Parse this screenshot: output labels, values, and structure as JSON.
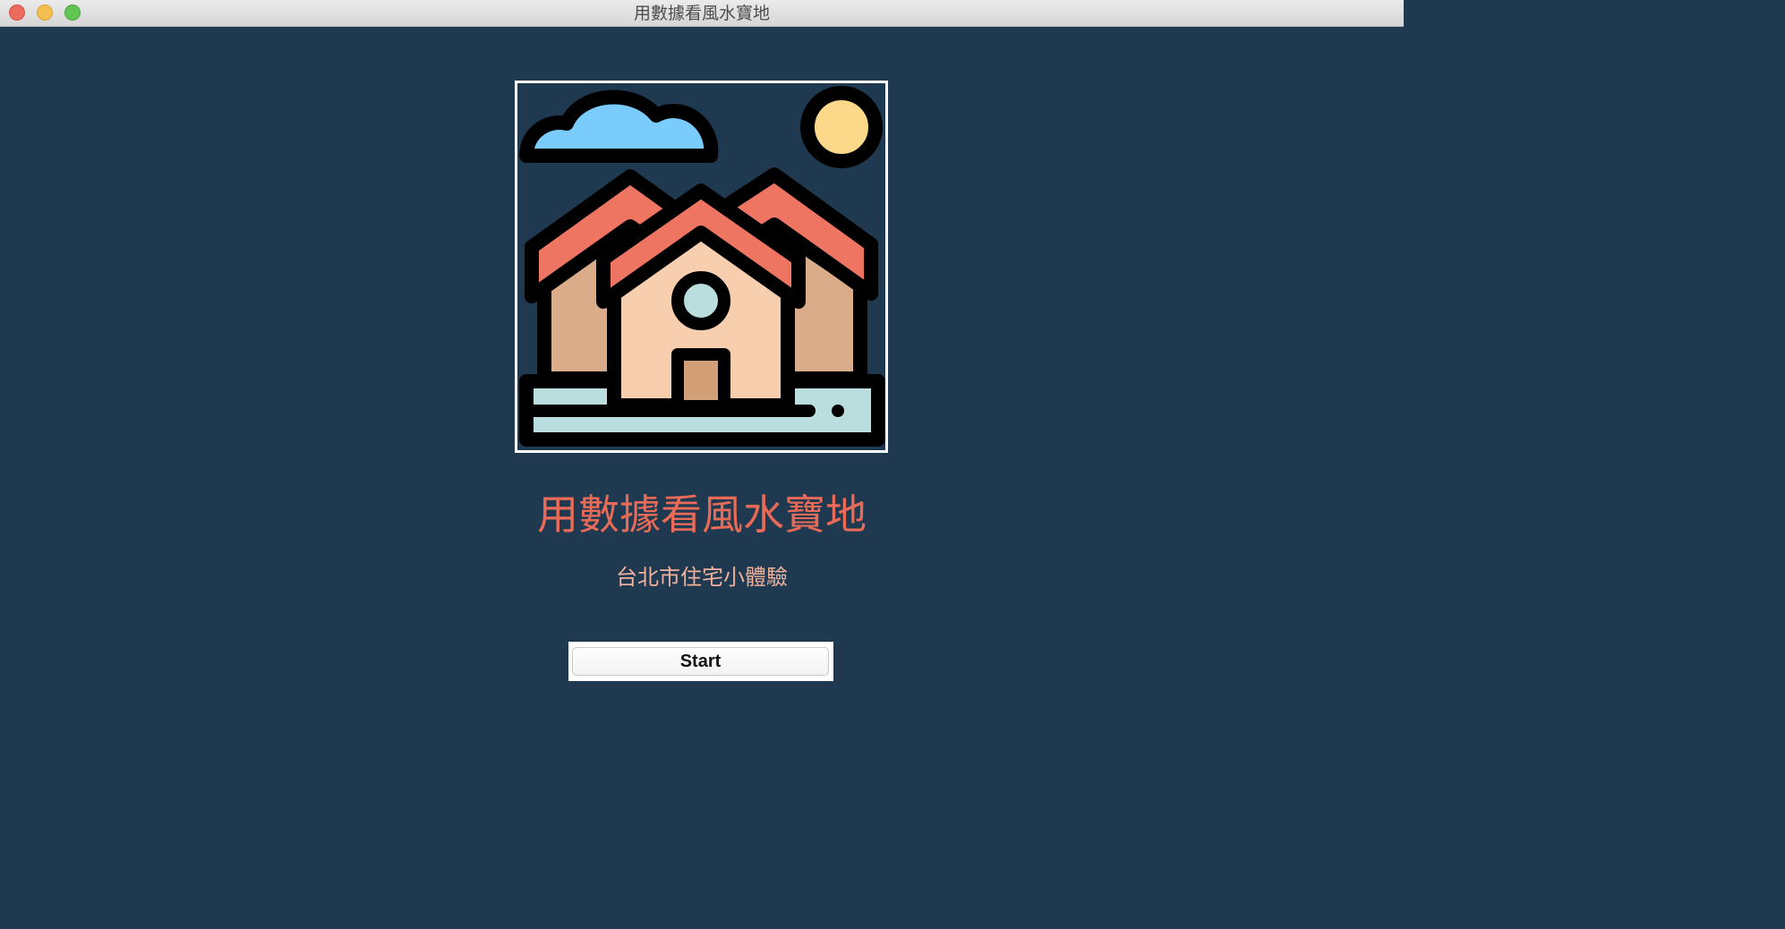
{
  "window": {
    "title": "用數據看風水寶地"
  },
  "hero": {
    "image_icon": "houses-illustration-icon",
    "colors": {
      "background": "#1f3a50",
      "cloud": "#79ccfb",
      "sun": "#fbd88a",
      "roof": "#ef7563",
      "front_wall": "#f7cfae",
      "side_wall": "#dbac8a",
      "door": "#d39f77",
      "window": "#b9dedd",
      "ground": "#b9dedd",
      "outline": "#000000"
    }
  },
  "main": {
    "headline": "用數據看風水寶地",
    "subheadline": "台北市住宅小體驗",
    "start_label": "Start"
  },
  "theme": {
    "background": "#1f3a50",
    "headline_color": "#e96b57",
    "subheadline_color": "#f1b09c"
  }
}
